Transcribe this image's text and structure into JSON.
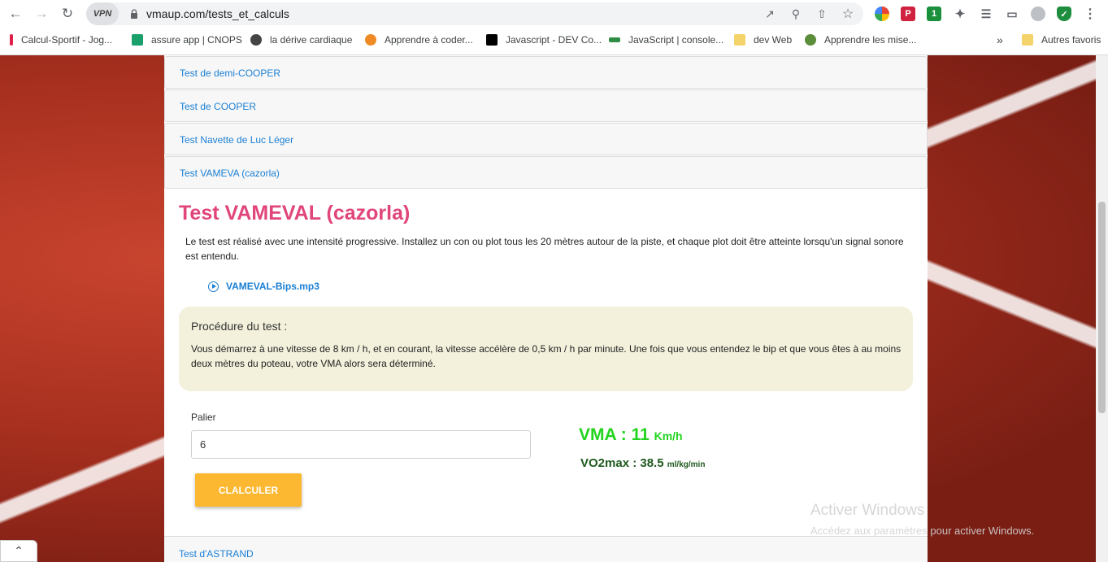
{
  "browser": {
    "url": "vmaup.com/tests_et_calculs",
    "vpn_label": "VPN",
    "bookmarks": [
      {
        "label": "Calcul-Sportif - Jog...",
        "color": "#e0204a"
      },
      {
        "label": "assure app | CNOPS",
        "color": "#1aa06b"
      },
      {
        "label": "la dérive cardiaque",
        "color": "#444444"
      },
      {
        "label": "Apprendre à coder...",
        "color": "#f08a24"
      },
      {
        "label": "Javascript - DEV Co...",
        "color": "#000000"
      },
      {
        "label": "JavaScript | console...",
        "color": "#2f8d46"
      },
      {
        "label": "dev Web",
        "color": "#f5d36b"
      },
      {
        "label": "Apprendre les mise...",
        "color": "#5b8d3a"
      }
    ],
    "other_bookmarks": "Autres favoris",
    "more_bookmarks": "»"
  },
  "accordion": {
    "items": [
      "Test de demi-COOPER",
      "Test de COOPER",
      "Test Navette de Luc Léger",
      "Test VAMEVA (cazorla)"
    ],
    "next_item": "Test d'ASTRAND"
  },
  "panel": {
    "title": "Test VAMEVAL (cazorla)",
    "description": "Le test est réalisé avec une intensité progressive. Installez un con ou plot tous les 20 mètres autour de la piste, et chaque plot doit être atteinte lorsqu'un signal sonore est entendu.",
    "audio_label": "VAMEVAL-Bips.mp3",
    "procedure_title": "Procédure du test :",
    "procedure_text": "Vous démarrez à une vitesse de 8 km / h, et en courant, la vitesse accélère de 0,5 km / h par minute. Une fois que vous entendez le bip et que vous êtes à au moins deux mètres du poteau, votre VMA alors sera déterminé.",
    "palier_label": "Palier",
    "palier_value": "6",
    "button_label": "CLALCULER",
    "vma_prefix": "VMA : ",
    "vma_value": "11",
    "vma_unit": "Km/h",
    "vo2_prefix": "VO2max : ",
    "vo2_value": "38.5",
    "vo2_unit": "ml/kg/min"
  },
  "watermark": {
    "title": "Activer Windows",
    "subtitle": "Accédez aux paramètres pour activer Windows."
  },
  "colors": {
    "title": "#e0457b",
    "link": "#1a7fd4",
    "button": "#fbb830",
    "vma": "#22d41e",
    "vo2": "#1e5a1e"
  }
}
